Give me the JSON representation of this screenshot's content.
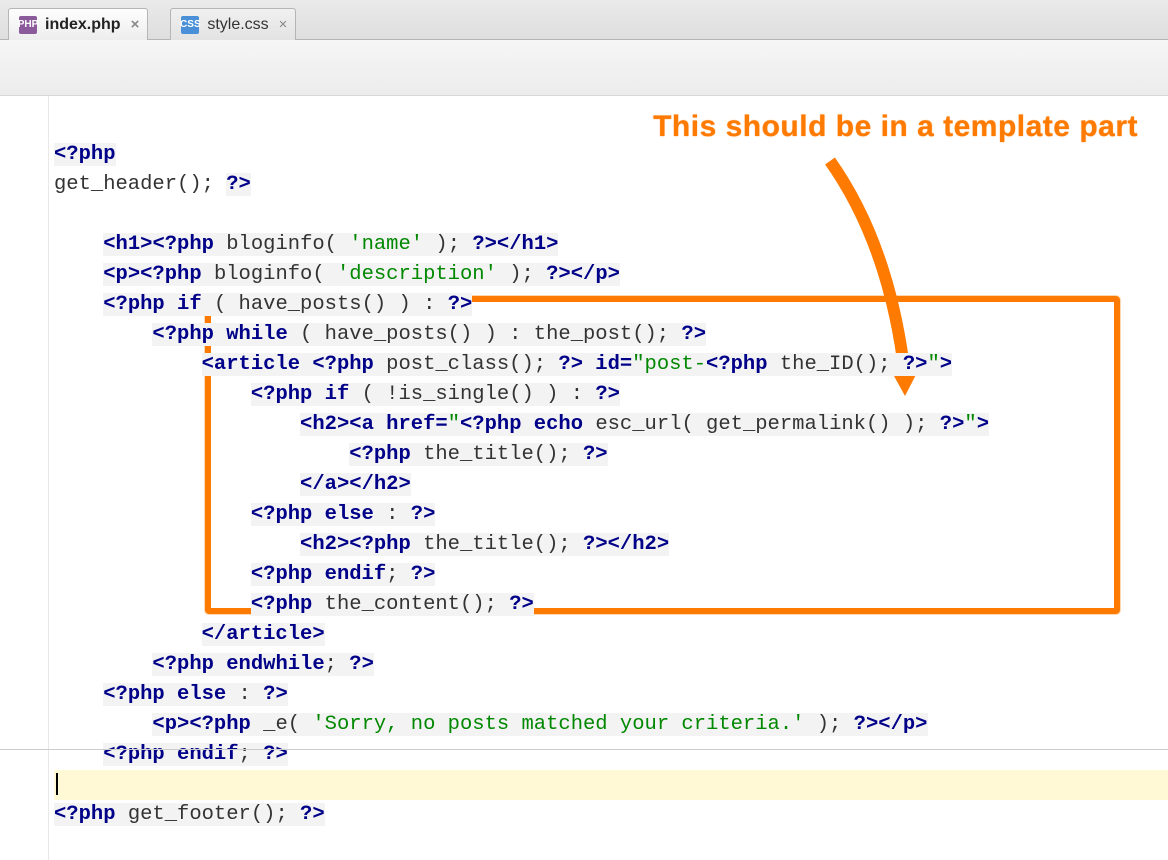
{
  "tabs": [
    {
      "icon_label": "PHP",
      "name": "index.php",
      "active": true
    },
    {
      "icon_label": "CSS",
      "name": "style.css",
      "active": false
    }
  ],
  "annotation": {
    "text": "This should be in a template part"
  },
  "code": {
    "l1a": "<?php",
    "l1b": "",
    "l2a": "get_header(); ",
    "l2b": "?>",
    "l4a": "    ",
    "l4b": "<h1>",
    "l4c": "<?php",
    "l4d": " bloginfo( ",
    "l4e": "'name'",
    "l4f": " ); ",
    "l4g": "?>",
    "l4h": "</h1>",
    "l5a": "    ",
    "l5b": "<p>",
    "l5c": "<?php",
    "l5d": " bloginfo( ",
    "l5e": "'description'",
    "l5f": " ); ",
    "l5g": "?>",
    "l5h": "</p>",
    "l6a": "    ",
    "l6b": "<?php if",
    "l6c": " ( have_posts() ) : ",
    "l6d": "?>",
    "l7a": "        ",
    "l7b": "<?php while",
    "l7c": " ( have_posts() ) : the_post(); ",
    "l7d": "?>",
    "l8a": "            ",
    "l8b": "<article ",
    "l8c": "<?php",
    "l8d": " post_class(); ",
    "l8e": "?>",
    "l8f": " id=",
    "l8g": "\"post-",
    "l8h": "<?php",
    "l8i": " the_ID(); ",
    "l8j": "?>",
    "l8k": "\"",
    "l8l": ">",
    "l9a": "                ",
    "l9b": "<?php if",
    "l9c": " ( !is_single() ) : ",
    "l9d": "?>",
    "l10a": "                    ",
    "l10b": "<h2>",
    "l10c": "<a href=",
    "l10d": "\"",
    "l10e": "<?php echo",
    "l10f": " esc_url( get_permalink() ); ",
    "l10g": "?>",
    "l10h": "\"",
    "l10i": ">",
    "l11a": "                        ",
    "l11b": "<?php",
    "l11c": " the_title(); ",
    "l11d": "?>",
    "l12a": "                    ",
    "l12b": "</a>",
    "l12c": "</h2>",
    "l13a": "                ",
    "l13b": "<?php else",
    "l13c": " : ",
    "l13d": "?>",
    "l14a": "                    ",
    "l14b": "<h2>",
    "l14c": "<?php",
    "l14d": " the_title(); ",
    "l14e": "?>",
    "l14f": "</h2>",
    "l15a": "                ",
    "l15b": "<?php endif",
    "l15c": "; ",
    "l15d": "?>",
    "l16a": "                ",
    "l16b": "<?php",
    "l16c": " the_content(); ",
    "l16d": "?>",
    "l17a": "            ",
    "l17b": "</article>",
    "l18a": "        ",
    "l18b": "<?php endwhile",
    "l18c": "; ",
    "l18d": "?>",
    "l19a": "    ",
    "l19b": "<?php else",
    "l19c": " : ",
    "l19d": "?>",
    "l20a": "        ",
    "l20b": "<p>",
    "l20c": "<?php",
    "l20d": " _e( ",
    "l20e": "'Sorry, no posts matched your criteria.'",
    "l20f": " ); ",
    "l20g": "?>",
    "l20h": "</p>",
    "l21a": "    ",
    "l21b": "<?php endif",
    "l21c": "; ",
    "l21d": "?>",
    "l23a": "<?php",
    "l23b": " get_footer(); ",
    "l23c": "?>"
  }
}
